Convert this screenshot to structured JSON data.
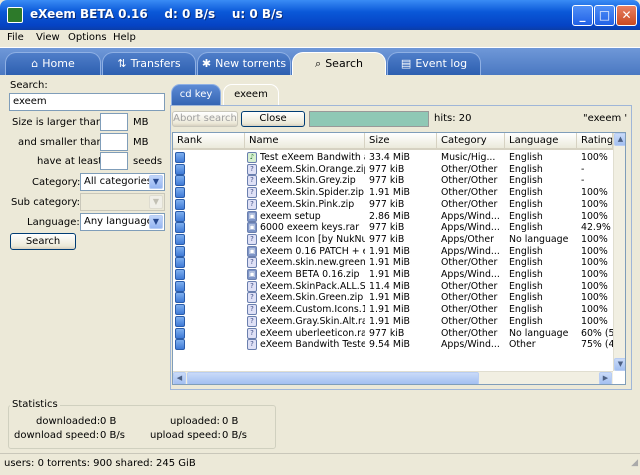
{
  "window": {
    "title": "eXeem BETA 0.16    d: 0 B/s    u: 0 B/s"
  },
  "menu": [
    "File",
    "View",
    "Options",
    "Help"
  ],
  "tabs": [
    {
      "label": "Home",
      "icon": "home-icon"
    },
    {
      "label": "Transfers",
      "icon": "transfers-icon"
    },
    {
      "label": "New torrents",
      "icon": "new-torrents-icon"
    },
    {
      "label": "Search",
      "icon": "search-icon"
    },
    {
      "label": "Event log",
      "icon": "event-log-icon"
    }
  ],
  "search_panel": {
    "search_label": "Search:",
    "search_value": "exeem",
    "size_larger_label": "Size is larger than",
    "size_larger_value": "",
    "size_larger_unit": "MB",
    "size_smaller_label": "and smaller than",
    "size_smaller_value": "",
    "size_smaller_unit": "MB",
    "seeds_label": "have at least",
    "seeds_value": "",
    "seeds_unit": "seeds",
    "category_label": "Category:",
    "category_value": "All categories",
    "subcategory_label": "Sub category:",
    "subcategory_value": "",
    "language_label": "Language:",
    "language_value": "Any language",
    "search_button": "Search"
  },
  "subtabs": [
    "cd key",
    "exeem"
  ],
  "results": {
    "abort_button": "Abort search",
    "close_button": "Close",
    "hits": "hits: 20",
    "query": "\"exeem \"",
    "progress_fraction": 1.0,
    "columns": [
      "Rank",
      "Name",
      "Size",
      "Category",
      "Language",
      "Rating"
    ],
    "rows": [
      {
        "icon": "music",
        "name": "Test eXeem Bandwith a",
        "size": "33.4 MiB",
        "category": "Music/Hig...",
        "language": "English",
        "rating": "100%"
      },
      {
        "icon": "unknown",
        "name": "eXeem.Skin.Orange.zip",
        "size": "977 kiB",
        "category": "Other/Other",
        "language": "English",
        "rating": "-"
      },
      {
        "icon": "unknown",
        "name": "eXeem.Skin.Grey.zip",
        "size": "977 kiB",
        "category": "Other/Other",
        "language": "English",
        "rating": "-"
      },
      {
        "icon": "unknown",
        "name": "eXeem.Skin.Spider.zip",
        "size": "1.91 MiB",
        "category": "Other/Other",
        "language": "English",
        "rating": "100%"
      },
      {
        "icon": "unknown",
        "name": "eXeem.Skin.Pink.zip",
        "size": "977 kiB",
        "category": "Other/Other",
        "language": "English",
        "rating": "100%"
      },
      {
        "icon": "app",
        "name": "exeem setup",
        "size": "2.86 MiB",
        "category": "Apps/Wind...",
        "language": "English",
        "rating": "100%"
      },
      {
        "icon": "app",
        "name": "6000 exeem keys.rar",
        "size": "977 kiB",
        "category": "Apps/Wind...",
        "language": "English",
        "rating": "42.9%"
      },
      {
        "icon": "unknown",
        "name": "eXeem Icon [by NukNuk",
        "size": "977 kiB",
        "category": "Apps/Other",
        "language": "No language",
        "rating": "100%"
      },
      {
        "icon": "app",
        "name": "eXeem 0.16 PATCH + e",
        "size": "1.91 MiB",
        "category": "Apps/Wind...",
        "language": "English",
        "rating": "100%"
      },
      {
        "icon": "unknown",
        "name": "eXeem.skin.new.green.z",
        "size": "1.91 MiB",
        "category": "Other/Other",
        "language": "English",
        "rating": "100%"
      },
      {
        "icon": "app",
        "name": "eXeem BETA 0.16.zip",
        "size": "1.91 MiB",
        "category": "Apps/Wind...",
        "language": "English",
        "rating": "100%"
      },
      {
        "icon": "unknown",
        "name": "eXeem.SkinPack.ALL.S",
        "size": "11.4 MiB",
        "category": "Other/Other",
        "language": "English",
        "rating": "100%"
      },
      {
        "icon": "unknown",
        "name": "eXeem.Skin.Green.zip",
        "size": "1.91 MiB",
        "category": "Other/Other",
        "language": "English",
        "rating": "100%"
      },
      {
        "icon": "unknown",
        "name": "eXeem.Custom.Icons.1.",
        "size": "1.91 MiB",
        "category": "Other/Other",
        "language": "English",
        "rating": "100%"
      },
      {
        "icon": "unknown",
        "name": "eXeem.Gray.Skin.Alt.rar",
        "size": "1.91 MiB",
        "category": "Other/Other",
        "language": "English",
        "rating": "100%"
      },
      {
        "icon": "unknown",
        "name": "eXeem uberleeticon.rar",
        "size": "977 kiB",
        "category": "Other/Other",
        "language": "No language",
        "rating": "60% (5"
      },
      {
        "icon": "unknown",
        "name": "eXeem Bandwith Tester",
        "size": "9.54 MiB",
        "category": "Apps/Wind...",
        "language": "Other",
        "rating": "75% (4"
      }
    ]
  },
  "statistics": {
    "title": "Statistics",
    "downloaded_label": "downloaded:",
    "downloaded_value": "0 B",
    "uploaded_label": "uploaded:",
    "uploaded_value": "0 B",
    "download_speed_label": "download speed:",
    "download_speed_value": "0 B/s",
    "upload_speed_label": "upload speed:",
    "upload_speed_value": "0 B/s"
  },
  "status_bar": "users: 0  torrents: 900  shared: 245 GiB",
  "colors": {
    "titlebar": "#0a58d8",
    "tab_blue": "#4a78c2",
    "progress": "#8fc8b5",
    "face": "#ece9d8"
  }
}
